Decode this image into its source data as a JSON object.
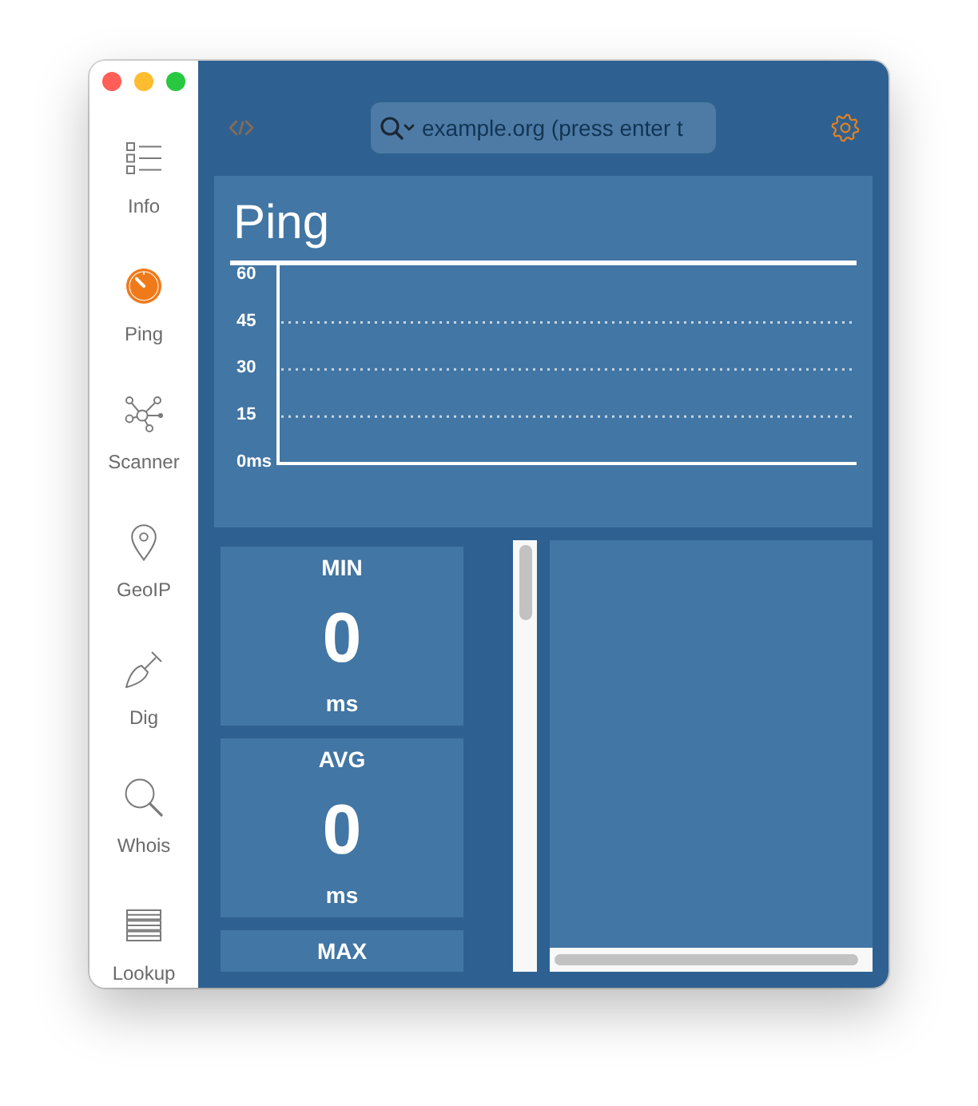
{
  "window_controls": [
    {
      "color": "#ff5f57"
    },
    {
      "color": "#febc2e"
    },
    {
      "color": "#28c840"
    }
  ],
  "sidebar": {
    "items": [
      {
        "label": "Info",
        "selected": false
      },
      {
        "label": "Ping",
        "selected": true
      },
      {
        "label": "Scanner",
        "selected": false
      },
      {
        "label": "GeoIP",
        "selected": false
      },
      {
        "label": "Dig",
        "selected": false
      },
      {
        "label": "Whois",
        "selected": false
      },
      {
        "label": "Lookup",
        "selected": false
      }
    ]
  },
  "toolbar": {
    "search": {
      "placeholder": "example.org (press enter t"
    }
  },
  "ping_panel": {
    "title": "Ping",
    "chart_data": {
      "type": "line",
      "categories": [
        null
      ],
      "ylim": [
        0,
        64
      ],
      "grid": true,
      "yticks": [
        {
          "value": 0,
          "label": "0ms"
        },
        {
          "value": 15,
          "label": "15"
        },
        {
          "value": 30,
          "label": "30"
        },
        {
          "value": 45,
          "label": "45"
        },
        {
          "value": 60,
          "label": "60"
        }
      ]
    }
  },
  "stats": [
    {
      "label": "MIN",
      "value": "0",
      "unit": "ms"
    },
    {
      "label": "AVG",
      "value": "0",
      "unit": "ms"
    },
    {
      "label": "MAX"
    }
  ]
}
